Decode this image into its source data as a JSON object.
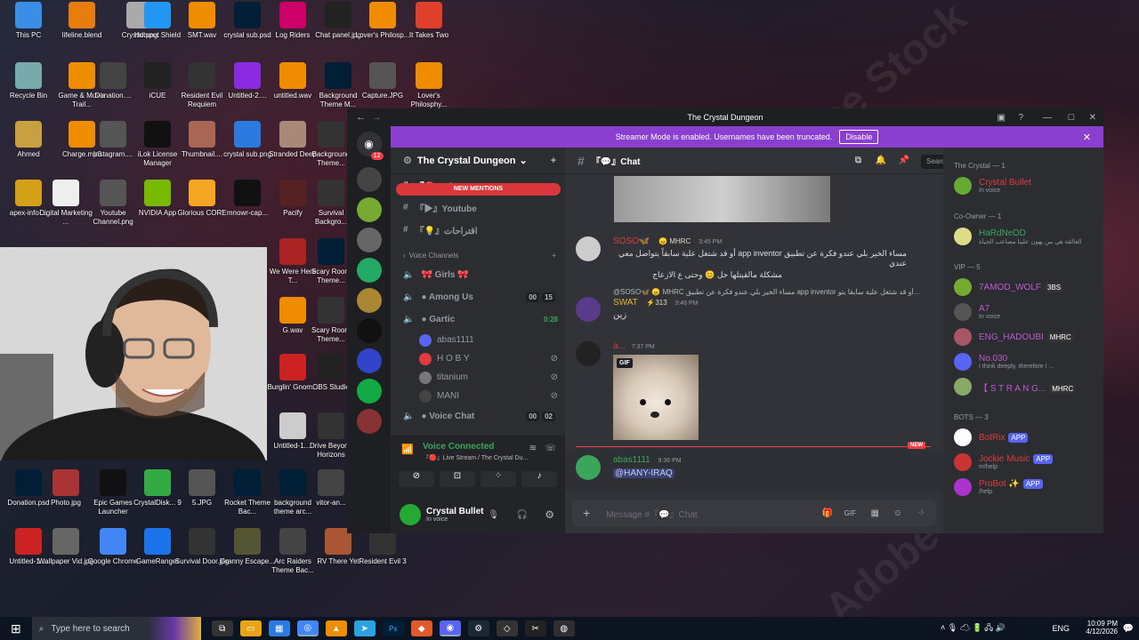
{
  "desktop": {
    "icons": [
      {
        "label": "This PC",
        "color": "#3a8ee6"
      },
      {
        "label": "lifeline.blend",
        "color": "#e87d0d"
      },
      {
        "label": "Crystal.png",
        "color": "#aaa"
      },
      {
        "label": "Hotspot Shield",
        "color": "#2196f3"
      },
      {
        "label": "SMT.wav",
        "color": "#f08c00"
      },
      {
        "label": "crystal sub.psd",
        "color": "#001e36"
      },
      {
        "label": "Log Riders",
        "color": "#c06"
      },
      {
        "label": "Chat panel.jpg",
        "color": "#222"
      },
      {
        "label": "Lover's Philosp...",
        "color": "#f08c00"
      },
      {
        "label": "It Takes Two",
        "color": "#e0402a"
      },
      {
        "label": "Recycle Bin",
        "color": "#7aa"
      },
      {
        "label": "Game & Movie Trail...",
        "color": "#f08c00"
      },
      {
        "label": "Donation....",
        "color": "#444"
      },
      {
        "label": "iCUE",
        "color": "#222"
      },
      {
        "label": "Resident Evil Requiem",
        "color": "#333"
      },
      {
        "label": "Untitled-2....",
        "color": "#8a2be2"
      },
      {
        "label": "untitled.wav",
        "color": "#f08c00"
      },
      {
        "label": "Background Theme M...",
        "color": "#001e36"
      },
      {
        "label": "Capture.JPG",
        "color": "#555"
      },
      {
        "label": "Lover's Philosphy...",
        "color": "#f08c00"
      },
      {
        "label": "Ahmed",
        "color": "#c8a040"
      },
      {
        "label": "Charge.mp3",
        "color": "#f08c00"
      },
      {
        "label": "Instagram....",
        "color": "#555"
      },
      {
        "label": "iLok License Manager",
        "color": "#111"
      },
      {
        "label": "Thumbnail....",
        "color": "#a65"
      },
      {
        "label": "crystal sub.png",
        "color": "#2a7ae2"
      },
      {
        "label": "Stranded Deep",
        "color": "#a87"
      },
      {
        "label": "Background Theme...",
        "color": "#333"
      },
      {
        "label": "apex-info-...",
        "color": "#d4a017"
      },
      {
        "label": "Digital Marketing ...",
        "color": "#eee"
      },
      {
        "label": "Youtube Channel.png",
        "color": "#555"
      },
      {
        "label": "NVIDIA App",
        "color": "#76b900"
      },
      {
        "label": "Glorious CORE",
        "color": "#f5a623"
      },
      {
        "label": "mnowr-cap...",
        "color": "#111"
      },
      {
        "label": "Pacify",
        "color": "#522"
      },
      {
        "label": "Survival Backgro...",
        "color": "#333"
      },
      {
        "label": "We Were Here T...",
        "color": "#a22"
      },
      {
        "label": "Scary Room Theme...",
        "color": "#001e36"
      },
      {
        "label": "Scary Room Theme...",
        "color": "#333"
      },
      {
        "label": "G.wav",
        "color": "#f08c00"
      },
      {
        "label": "Burglin' Gnom...",
        "color": "#c22"
      },
      {
        "label": "OBS Studio",
        "color": "#222"
      },
      {
        "label": "Untitled-1....",
        "color": "#ccc"
      },
      {
        "label": "Drive Beyond Horizons",
        "color": "#333"
      },
      {
        "label": "Donation.psd",
        "color": "#001e36"
      },
      {
        "label": "Photo.jpg",
        "color": "#a33"
      },
      {
        "label": "Epic Games Launcher",
        "color": "#111"
      },
      {
        "label": "CrystalDisk... 9",
        "color": "#3a4"
      },
      {
        "label": "5.JPG",
        "color": "#555"
      },
      {
        "label": "Rocket Theme Bac...",
        "color": "#001e36"
      },
      {
        "label": "background theme arc...",
        "color": "#001e36"
      },
      {
        "label": "vitor-an...",
        "color": "#444"
      },
      {
        "label": "Untitled-1....",
        "color": "#c22"
      },
      {
        "label": "Wallpaper Vid.jpg",
        "color": "#666"
      },
      {
        "label": "Google Chrome",
        "color": "#4285f4"
      },
      {
        "label": "GameRanger",
        "color": "#1a73e8"
      },
      {
        "label": "Survival Door.jpg",
        "color": "#333"
      },
      {
        "label": "Granny Escape...",
        "color": "#553"
      },
      {
        "label": "Arc Raiders Theme Bac...",
        "color": "#444"
      },
      {
        "label": "RV There Yet",
        "color": "#a53"
      },
      {
        "label": "Resident Evil 3",
        "color": "#333"
      }
    ]
  },
  "discord": {
    "window_title": "The Crystal Dungeon",
    "streamer_text": "Streamer Mode is enabled. Usernames have been truncated.",
    "disable_label": "Disable",
    "rail_badge": "12",
    "server_name": "The Crystal Dungeon",
    "new_mentions": "NEW MENTIONS",
    "channels": {
      "live": "『🔴』Live",
      "youtube": "『▶』Youtube",
      "suggestions": "『💡』اقتراحات",
      "voice_header": "Voice Channels",
      "girls": "🎀 Girls 🎀",
      "among": "● Among Us",
      "among_a": "00",
      "among_b": "15",
      "gartic": "● Gartic",
      "gartic_time": "0:28",
      "users": [
        "abas1111",
        "H O B Y",
        "titanium",
        "MANI"
      ],
      "voicechat": "● Voice Chat",
      "vc_a": "00",
      "vc_b": "02"
    },
    "voice": {
      "status": "Voice Connected",
      "channel": "『🔴』Live Stream / The Crystal Du..."
    },
    "user": {
      "name": "Crystal Bullet",
      "status": "In voice"
    },
    "chat": {
      "channel": "『💬』Chat",
      "search_placeholder": "Search The Crystal Dungeon",
      "messages": [
        {
          "author": "SOSO🦋",
          "tag": "😠 MHRC",
          "time": "3:45 PM",
          "text1": "مساء الخير بلي عندو فكرة عن تطبيق app inventor أو قد شتغل علية سابقاً يتواصل معي عندي",
          "text2": "مشكلة مالقيتلها حل 😊 وحتى ع الازعاج"
        },
        {
          "reply": "@SOSO🦋 😠 MHRC مساء الخير بلي عندو فكرة عن تطبيق app inventor أو قد شتغل علية سابقاً يتو...",
          "author": "SWAT",
          "tag": "⚡313",
          "time": "3:46 PM",
          "text1": "زين"
        },
        {
          "author": "a...",
          "time": "7:37 PM",
          "gif": "GIF"
        },
        {
          "author": "abas1111",
          "time": "9:36 PM",
          "mention": "@HANY-IRAQ",
          "new": "NEW"
        }
      ],
      "input_placeholder": "Message #『💬』Chat"
    },
    "members": {
      "groups": [
        {
          "title": "The Crystal — 1",
          "items": [
            {
              "name": "Crystal Bullet",
              "sub": "In voice",
              "color": "#e03c3c"
            }
          ]
        },
        {
          "title": "Co-Owner — 1",
          "items": [
            {
              "name": "HaRdNeDD",
              "sub": "العالقة هي من يهون علينا مصاعب الحياة",
              "color": "#3ba55c"
            }
          ]
        },
        {
          "title": "VIP — 5",
          "items": [
            {
              "name": "7AMOD_WOLF",
              "badge": "3BS",
              "color": "#c05ad0"
            },
            {
              "name": "A7",
              "sub": "In voice",
              "color": "#c05ad0"
            },
            {
              "name": "ENG_HADOUBI",
              "badge": "MHRC",
              "color": "#c05ad0"
            },
            {
              "name": "No.030",
              "sub": "I think deeply, therefore I ...",
              "color": "#c05ad0"
            },
            {
              "name": "【 S T R A N G...",
              "badge": "MHRC",
              "color": "#c05ad0"
            }
          ]
        },
        {
          "title": "BOTS — 3",
          "items": [
            {
              "name": "BotRix",
              "badge": "APP",
              "color": "#e03c3c"
            },
            {
              "name": "Jockie Music",
              "badge": "APP",
              "sub": "m!help",
              "color": "#e03c3c"
            },
            {
              "name": "ProBot ✨",
              "badge": "APP",
              "sub": "/help",
              "color": "#e03c3c"
            }
          ]
        }
      ]
    }
  },
  "taskbar": {
    "search": "Type here to search",
    "lang": "ENG",
    "time": "10:09 PM",
    "date": "4/12/2026"
  }
}
